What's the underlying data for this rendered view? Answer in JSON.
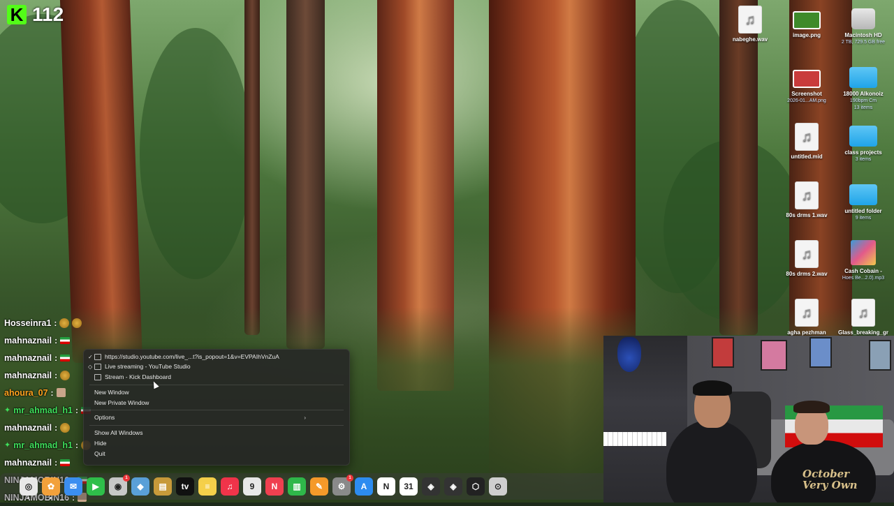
{
  "overlay": {
    "viewer_count": "112",
    "kick_logo_letter": "K",
    "brand_color": "#53fc18"
  },
  "desktop_icons": [
    {
      "name": "nabeghe.wav",
      "sub": "",
      "type": "audio"
    },
    {
      "name": "image.png",
      "sub": "",
      "type": "image-green"
    },
    {
      "name": "Macintosh HD",
      "sub": "2 TB, 729.5 GB free",
      "type": "disk"
    },
    {
      "name": "Screenshot",
      "sub": "2026-01...AM.png",
      "type": "image-red"
    },
    {
      "name": "18000 Alkonoiz",
      "sub": "190bpm Cm",
      "sub2": "13 items",
      "type": "folder"
    },
    {
      "name": "untitled.mid",
      "sub": "",
      "type": "audio"
    },
    {
      "name": "class projects",
      "sub": "3 items",
      "type": "folder"
    },
    {
      "name": "80s drms 1.wav",
      "sub": "",
      "type": "audio"
    },
    {
      "name": "untitled folder",
      "sub": "9 items",
      "type": "folder"
    },
    {
      "name": "80s drms 2.wav",
      "sub": "",
      "type": "audio"
    },
    {
      "name": "Cash Cobain -",
      "sub": "Hoes Be...2.0).mp3",
      "type": "art"
    },
    {
      "name": "agha pezhman",
      "sub": "",
      "type": "audio"
    },
    {
      "name": "Glass_breaking_gr",
      "sub": "",
      "type": "audio"
    }
  ],
  "chat": [
    {
      "user": "Hosseinra1",
      "sep": ":",
      "color": "white",
      "badge": false,
      "emotes": [
        "lion",
        "lion"
      ]
    },
    {
      "user": "mahnaznail",
      "sep": ":",
      "color": "white",
      "badge": false,
      "emotes": [
        "flag"
      ]
    },
    {
      "user": "mahnaznail",
      "sep": ":",
      "color": "white",
      "badge": false,
      "emotes": [
        "flag"
      ]
    },
    {
      "user": "mahnaznail",
      "sep": ":",
      "color": "white",
      "badge": false,
      "emotes": [
        "lion"
      ]
    },
    {
      "user": "ahoura_07",
      "sep": ":",
      "color": "orange",
      "badge": false,
      "emotes": [
        "face"
      ]
    },
    {
      "user": "mr_ahmad_h1",
      "sep": ":",
      "color": "green",
      "badge": true,
      "emotes": [
        "flag"
      ]
    },
    {
      "user": "mahnaznail",
      "sep": ":",
      "color": "white",
      "badge": false,
      "emotes": [
        "lion"
      ]
    },
    {
      "user": "mr_ahmad_h1",
      "sep": ":",
      "color": "green",
      "badge": true,
      "emotes": [
        "lion"
      ]
    },
    {
      "user": "mahnaznail",
      "sep": ":",
      "color": "white",
      "badge": false,
      "emotes": [
        "flag"
      ]
    },
    {
      "user": "NINJAMOBIN16",
      "sep": ":",
      "color": "white",
      "badge": false,
      "emotes": [
        "flag"
      ]
    },
    {
      "user": "NINJAMOBIN16",
      "sep": ":",
      "color": "white",
      "badge": false,
      "emotes": [
        "face"
      ]
    }
  ],
  "context_menu": {
    "windows": [
      {
        "label": "https://studio.youtube.com/live_...t?is_popout=1&v=EVPAIhVnZuA",
        "checked": true
      },
      {
        "label": "Live streaming - YouTube Studio",
        "checked": false,
        "diamond": true
      },
      {
        "label": "Stream - Kick Dashboard",
        "checked": false
      }
    ],
    "new_window": "New Window",
    "new_private_window": "New Private Window",
    "options": "Options",
    "submenu_arrow": "›",
    "show_all_windows": "Show All Windows",
    "hide": "Hide",
    "quit": "Quit"
  },
  "dock": {
    "apps": [
      {
        "name": "chrome",
        "color": "#e8e8e8",
        "glyph": "◎"
      },
      {
        "name": "photos",
        "color": "#f2a13b",
        "glyph": "✿"
      },
      {
        "name": "mail",
        "color": "#3b8ef0",
        "glyph": "✉"
      },
      {
        "name": "facetime",
        "color": "#2fbf4a",
        "glyph": "▶"
      },
      {
        "name": "messages",
        "color": "#c8c8c8",
        "glyph": "◉",
        "badge": "1"
      },
      {
        "name": "maps",
        "color": "#5aa0d8",
        "glyph": "◆"
      },
      {
        "name": "notes-app",
        "color": "#c89a3a",
        "glyph": "▤"
      },
      {
        "name": "apple-tv",
        "color": "#111111",
        "glyph": "tv"
      },
      {
        "name": "notes",
        "color": "#f5d04a",
        "glyph": "≡"
      },
      {
        "name": "music",
        "color": "#f0344a",
        "glyph": "♫"
      },
      {
        "name": "calendar",
        "color": "#e8e8e8",
        "glyph": "9"
      },
      {
        "name": "news",
        "color": "#f04050",
        "glyph": "N"
      },
      {
        "name": "numbers",
        "color": "#2fb84a",
        "glyph": "▥"
      },
      {
        "name": "pages",
        "color": "#f59a2a",
        "glyph": "✎"
      },
      {
        "name": "system-settings",
        "color": "#8a8a8a",
        "glyph": "⚙",
        "badge": "1"
      },
      {
        "name": "app-store",
        "color": "#2d8cf0",
        "glyph": "A"
      },
      {
        "name": "notion",
        "color": "#ffffff",
        "glyph": "N"
      },
      {
        "name": "fantastical",
        "color": "#ffffff",
        "glyph": "31"
      },
      {
        "name": "logic-pro",
        "color": "#333333",
        "glyph": "◈"
      },
      {
        "name": "logic-remote",
        "color": "#333333",
        "glyph": "◈"
      },
      {
        "name": "unity",
        "color": "#222222",
        "glyph": "⬡"
      },
      {
        "name": "disk-utility",
        "color": "#cfcfcf",
        "glyph": "⊙"
      }
    ]
  },
  "webcam": {
    "hoodie_line1": "October",
    "hoodie_line2": "Very Own"
  }
}
